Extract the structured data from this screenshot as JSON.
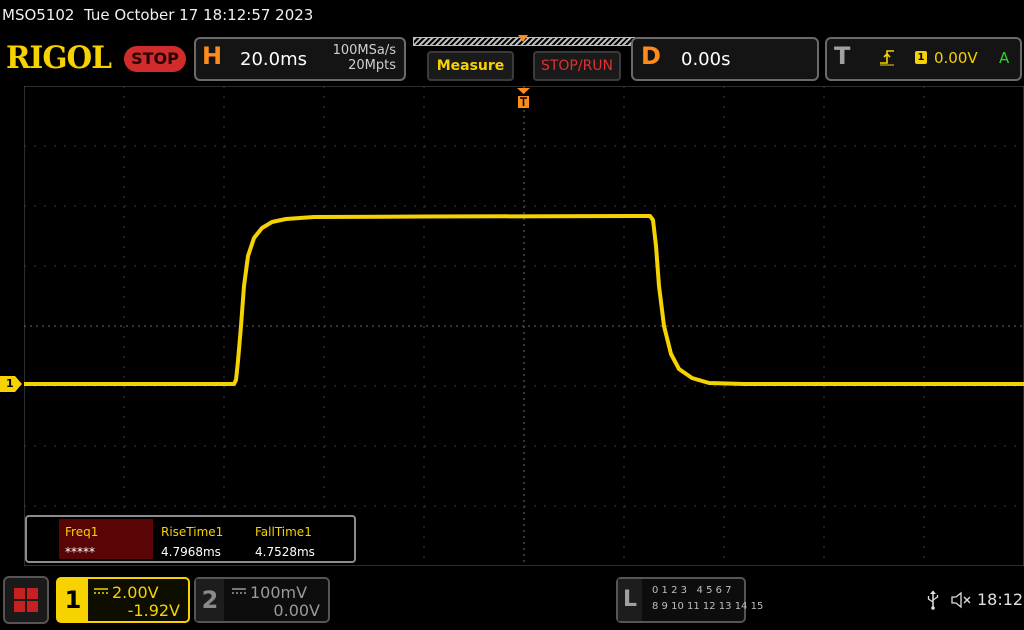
{
  "header": {
    "model": "MSO5102",
    "datetime": "Tue October 17 18:12:57 2023"
  },
  "topbar": {
    "logo": "RIGOL",
    "run_state": "STOP",
    "horizontal": {
      "letter": "H",
      "timebase": "20.0ms",
      "sample_rate": "100MSa/s",
      "memory_depth": "20Mpts"
    },
    "measure_label": "Measure",
    "stoprun_label": "STOP/RUN",
    "delay": {
      "letter": "D",
      "value": "0.00s"
    },
    "trigger": {
      "letter": "T",
      "source_badge": "1",
      "level": "0.00V",
      "mode": "A"
    }
  },
  "display": {
    "ch1_marker_label": "1",
    "trace_color": "#f5d200"
  },
  "measurements": [
    {
      "label": "Freq1",
      "value": "*****"
    },
    {
      "label": "RiseTime1",
      "value": "4.7968ms"
    },
    {
      "label": "FallTime1",
      "value": "4.7528ms"
    }
  ],
  "channels": {
    "ch1": {
      "number": "1",
      "scale": "2.00V",
      "offset": "-1.92V"
    },
    "ch2": {
      "number": "2",
      "scale": "100mV",
      "offset": "0.00V"
    }
  },
  "logic_analyzer": {
    "letter": "L",
    "row1": "0 1 2 3   4 5 6 7",
    "row2": "8 9 10 11 12 13 14 15"
  },
  "statusbar": {
    "time": "18:12"
  },
  "colors": {
    "ch1": "#f5d200",
    "accent_orange": "#ff8c1a",
    "stop_red": "#d02c2c"
  }
}
